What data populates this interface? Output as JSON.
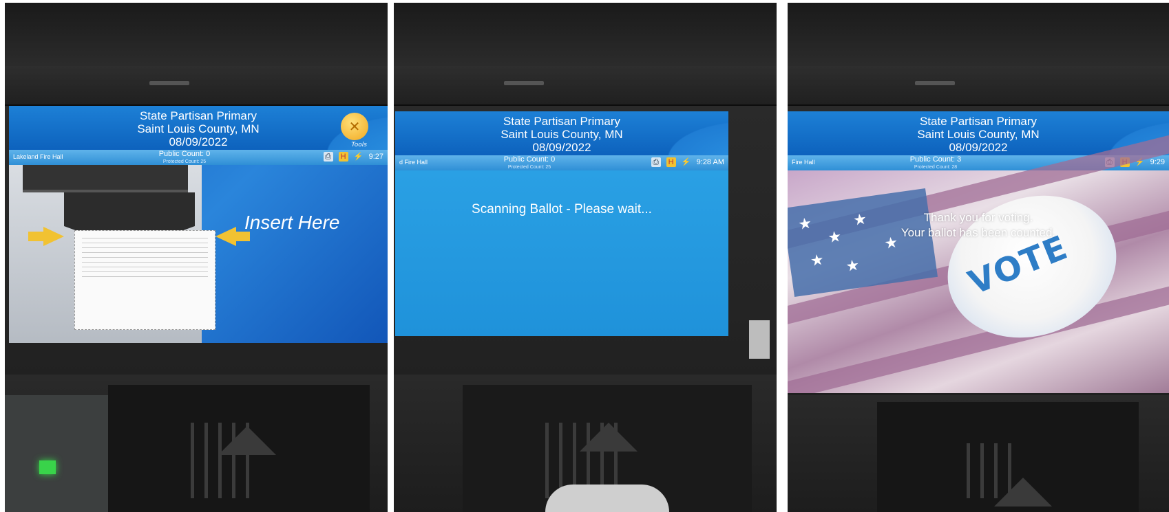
{
  "panels": [
    {
      "header": {
        "title": "State Partisan Primary",
        "county": "Saint Louis County, MN",
        "date": "08/09/2022"
      },
      "status": {
        "location": "Lakeland Fire Hall",
        "public_count": "Public Count: 0",
        "protected_count": "Protected Count: 25",
        "time": "9:27"
      },
      "tools_label": "Tools",
      "message": "Insert Here"
    },
    {
      "header": {
        "title": "State Partisan Primary",
        "county": "Saint Louis County, MN",
        "date": "08/09/2022"
      },
      "status": {
        "location": "d Fire Hall",
        "public_count": "Public Count: 0",
        "protected_count": "Protected Count: 25",
        "time": "9:28 AM"
      },
      "message": "Scanning Ballot - Please wait..."
    },
    {
      "header": {
        "title": "State Partisan Primary",
        "county": "Saint Louis County, MN",
        "date": "08/09/2022"
      },
      "status": {
        "location": "Fire Hall",
        "public_count": "Public Count: 3",
        "protected_count": "Protected Count: 28",
        "time": "9:29"
      },
      "message_line1": "Thank you for voting.",
      "message_line2": "Your ballot has been counted.",
      "badge_text": "VOTE"
    }
  ],
  "icons": [
    "printer-icon",
    "h-icon",
    "plug-icon"
  ],
  "colors": {
    "screen_blue": "#0f5fbb",
    "arrow_yellow": "#f1c232",
    "vote_blue": "#2e7dc6"
  }
}
